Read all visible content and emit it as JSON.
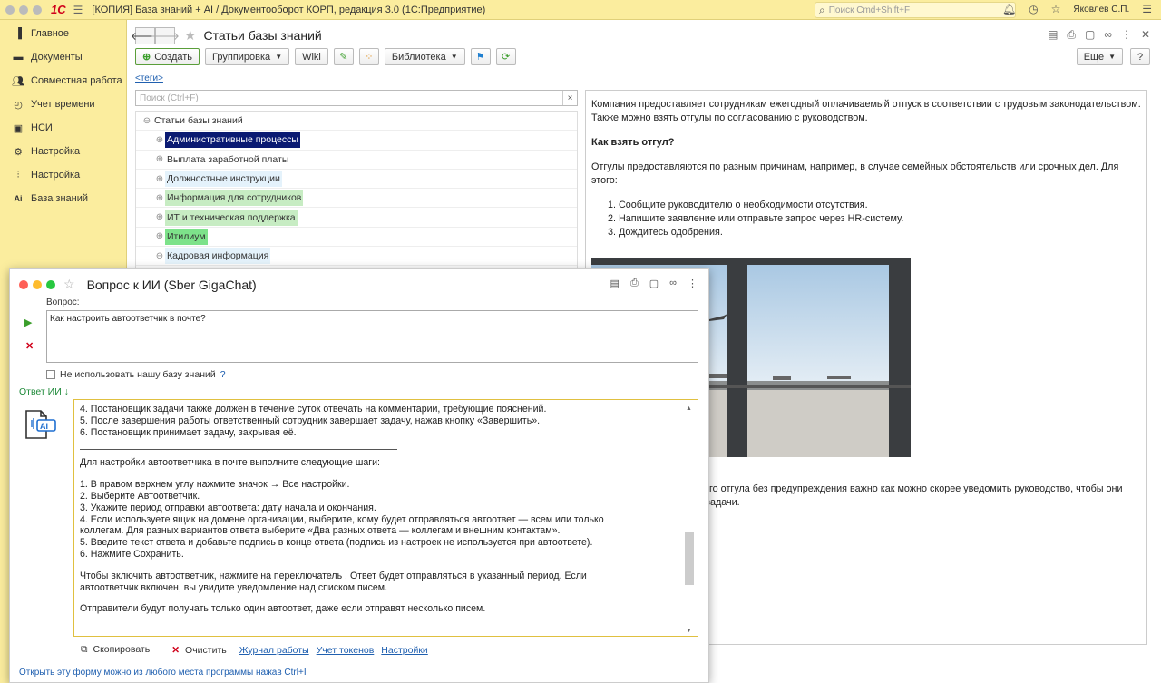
{
  "titlebar": {
    "logo": "1С",
    "title": "[КОПИЯ] База знаний + AI / Документооборот КОРП, редакция 3.0  (1С:Предприятие)",
    "search_placeholder": "Поиск Cmd+Shift+F",
    "user": "Яковлев С.П."
  },
  "sidebar": {
    "items": [
      {
        "label": "Главное",
        "icon": "menu-icon"
      },
      {
        "label": "Документы",
        "icon": "folder-icon"
      },
      {
        "label": "Совместная работа",
        "icon": "people-icon"
      },
      {
        "label": "Учет времени",
        "icon": "clock-icon"
      },
      {
        "label": "НСИ",
        "icon": "book-icon"
      },
      {
        "label": "Настройка",
        "icon": "gear-icon"
      },
      {
        "label": "Настройка",
        "icon": "sliders-icon"
      },
      {
        "label": "База знаний",
        "icon": "ai-icon"
      }
    ]
  },
  "page": {
    "title": "Статьи базы знаний",
    "tags_link": "<теги>",
    "search_placeholder": "Поиск (Ctrl+F)"
  },
  "toolbar": {
    "create": "Создать",
    "grouping": "Группировка",
    "wiki": "Wiki",
    "library": "Библиотека",
    "more": "Еще",
    "help": "?"
  },
  "tree": {
    "root": "Статьи базы знаний",
    "nodes": [
      {
        "label": "Административные процессы",
        "bg": "#0a1a72",
        "fg": "#ffffff"
      },
      {
        "label": "Выплата заработной платы",
        "bg": "#ffffff",
        "fg": "#333333"
      },
      {
        "label": "Должностные инструкции",
        "bg": "#e4f2fb",
        "fg": "#333333"
      },
      {
        "label": "Информация для сотрудников",
        "bg": "#c7ecc3",
        "fg": "#333333"
      },
      {
        "label": "ИТ и техническая поддержка",
        "bg": "#c7ecc3",
        "fg": "#333333"
      },
      {
        "label": "Итилиум",
        "bg": "#7de28a",
        "fg": "#333333"
      },
      {
        "label": "Кадровая информация",
        "bg": "#e4f2fb",
        "fg": "#333333"
      }
    ]
  },
  "article": {
    "p1": "Компания предоставляет сотрудникам ежегодный оплачиваемый отпуск в соответствии с трудовым законодательством. Также можно взять отгулы по согласованию с руководством.",
    "h1": "Как взять отгул?",
    "p2": "Отгулы предоставляются по разным причинам, например, в случае семейных обстоятельств или срочных дел. Для этого:",
    "steps": [
      "Сообщите руководителю о необходимости отсутствия.",
      "Напишите заявление или отправьте запрос через HR-систему.",
      "Дождитесь одобрения."
    ],
    "tail1": "ного отгула без предупреждения важно как можно скорее уведомить руководство, чтобы они",
    "tail2": "задачи."
  },
  "dialog": {
    "title": "Вопрос к ИИ (Sber GigaChat)",
    "question_label": "Вопрос:",
    "question_value": "Как настроить автоответчик в почте?",
    "checkbox_label": "Не использовать нашу базу знаний",
    "help": "?",
    "answer_label": "Ответ ИИ ↓",
    "answer_top": [
      "4. Постановщик задачи также должен в течение суток отвечать на комментарии, требующие пояснений.",
      "5. После завершения работы ответственный сотрудник завершает задачу, нажав кнопку «Завершить».",
      "6. Постановщик принимает задачу, закрывая её."
    ],
    "answer_intro": "Для настройки автоответчика в почте выполните следующие шаги:",
    "answer_steps": [
      "1. В правом верхнем углу нажмите значок → Все настройки.",
      "2. Выберите Автоответчик.",
      "3. Укажите период отправки автоответа: дату начала и окончания.",
      "4. Если используете ящик на домене организации, выберите, кому будет отправляться автоответ — всем или только",
      "коллегам. Для разных вариантов ответа выберите «Два разных ответа — коллегам и внешним контактам».",
      "5. Введите текст ответа и добавьте подпись в конце ответа (подпись из настроек не используется при автоответе).",
      "6. Нажмите Сохранить."
    ],
    "answer_p1a": "Чтобы включить автоответчик, нажмите на переключатель . Ответ будет отправляться в указанный период. Если",
    "answer_p1b": "автоответчик включен, вы увидите уведомление над списком писем.",
    "answer_p2": "Отправители будут получать только один автоответ, даже если отправят несколько писем.",
    "copy": "Скопировать",
    "clear": "Очистить",
    "journal": "Журнал работы",
    "tokens": "Учет токенов",
    "settings": "Настройки",
    "footer": "Открыть эту форму можно из любого места программы нажав Ctrl+I"
  }
}
